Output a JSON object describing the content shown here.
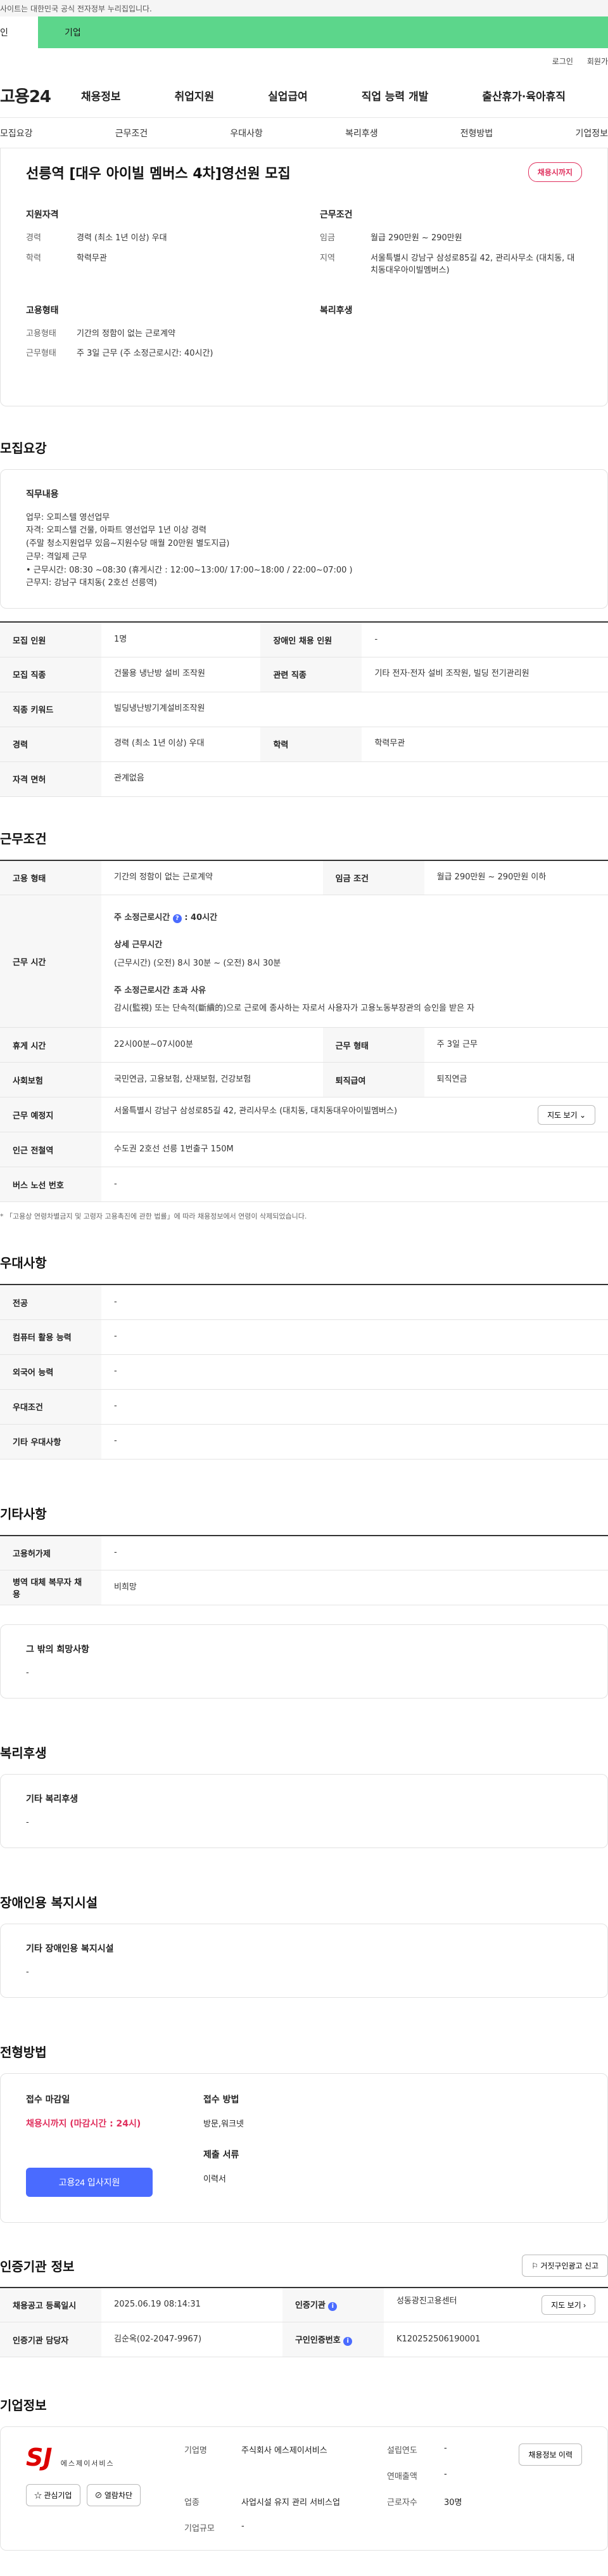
{
  "top": {
    "gov_notice": "사이트는 대한민국 공식 전자정부 누리집입니다.",
    "tab_personal": "인",
    "tab_company": "기업",
    "login": "로그인",
    "signup": "회원가"
  },
  "gnb": {
    "logo": "고용24",
    "items": [
      "채용정보",
      "취업지원",
      "실업급여",
      "직업 능력 개발",
      "출산휴가·육아휴직"
    ]
  },
  "anchor_nav": [
    "모집요강",
    "근무조건",
    "우대사항",
    "복리후생",
    "전형방법",
    "기업정보"
  ],
  "job": {
    "title": "선릉역 [대우 아이빌 멤버스 4차]영선원 모집",
    "badge": "채용시까지",
    "qual_head": "지원자격",
    "career_k": "경력",
    "career_v": "경력 (최소 1년 이상) 우대",
    "edu_k": "학력",
    "edu_v": "학력무관",
    "cond_head": "근무조건",
    "wage_k": "임금",
    "wage_v": "월급 290만원 ~ 290만원",
    "region_k": "지역",
    "region_v": "서울특별시 강남구 삼성로85길 42, 관리사무소 (대치동, 대치동대우아이빌멤버스)",
    "emp_head": "고용형태",
    "emp_type_k": "고용형태",
    "emp_type_v": "기간의 정함이 없는 근로계약",
    "work_form_k": "근무형태",
    "work_form_v": "주 3일 근무 (주 소정근로시간: 40시간)",
    "welfare_head": "복리후생"
  },
  "recruit": {
    "title": "모집요강",
    "duty_head": "직무내용",
    "duty_text": "업무: 오피스텔 영선업무\n자격: 오피스텔 건물, 아파트 영선업무 1년 이상 경력\n       (주말 청소지원업무 있음~지원수당 매월 20만원 별도지급)\n근무: 격일제 근무\n• 근무시간:  08:30 ~08:30 (휴게시간 : 12:00~13:00/ 17:00~18:00 / 22:00~07:00 )\n근무지: 강남구 대치동( 2호선 선릉역)",
    "rows": {
      "headcount_k": "모집 인원",
      "headcount_v": "1명",
      "disabled_k": "장애인 채용 인원",
      "disabled_v": "-",
      "job_k": "모집 직종",
      "job_v": "건물용 냉난방 설비 조작원",
      "rel_job_k": "관련 직종",
      "rel_job_v": "기타 전자·전자 설비 조작원, 빌딩 전기관리원",
      "keyword_k": "직종 키워드",
      "keyword_v": "빌딩냉난방기계설비조작원",
      "career_k": "경력",
      "career_v": "경력 (최소 1년 이상) 우대",
      "edu_k": "학력",
      "edu_v": "학력무관",
      "license_k": "자격 면허",
      "license_v": "관계없음"
    }
  },
  "conditions": {
    "title": "근무조건",
    "emp_type_k": "고용 형태",
    "emp_type_v": "기간의 정함이 없는 근로계약",
    "wage_k": "임금 조건",
    "wage_v": "월급 290만원 ~ 290만원 이하",
    "worktime_k": "근무 시간",
    "weekly_label": "주 소정근로시간",
    "weekly_hours": ": 40시간",
    "detail_label": "상세 근무시간",
    "detail_text": "(근무시간) (오전) 8시 30분 ~ (오전) 8시 30분",
    "excess_label": "주 소정근로시간 초과 사유",
    "excess_text": "감시(監視) 또는 단속적(斷續的)으로 근로에 종사하는 자로서 사용자가 고용노동부장관의 승인을 받은 자",
    "break_k": "휴게 시간",
    "break_v": "22시00분~07시00분",
    "work_form_k": "근무 형태",
    "work_form_v": "주 3일 근무",
    "insurance_k": "사회보험",
    "insurance_v": "국민연금, 고용보험, 산재보험, 건강보험",
    "severance_k": "퇴직급여",
    "severance_v": "퇴직연금",
    "location_k": "근무 예정지",
    "location_v": "서울특별시 강남구 삼성로85길 42, 관리사무소 (대치동, 대치동대우아이빌멤버스)",
    "map_btn": "지도 보기",
    "subway_k": "인근 전철역",
    "subway_v": "수도권 2호선 선릉 1번출구 150M",
    "bus_k": "버스 노선 번호",
    "bus_v": "-",
    "note": "* 「고용상 연령차별금지 및 고령자 고용촉진에 관한 법률」에 따라 채용정보에서 연령이 삭제되었습니다."
  },
  "preference": {
    "title": "우대사항",
    "major_k": "전공",
    "major_v": "-",
    "computer_k": "컴퓨터 활용 능력",
    "computer_v": "-",
    "language_k": "외국어 능력",
    "language_v": "-",
    "pref_k": "우대조건",
    "pref_v": "-",
    "etc_k": "기타 우대사항",
    "etc_v": "-"
  },
  "others": {
    "title": "기타사항",
    "permit_k": "고용허가제",
    "permit_v": "-",
    "military_k": "병역 대체 복무자 채용",
    "military_v": "비희망",
    "wish_head": "그 밖의 희망사항",
    "wish_v": "-"
  },
  "welfare": {
    "title": "복리후생",
    "head": "기타 복리후생",
    "v": "-"
  },
  "disabled_facility": {
    "title": "장애인용 복지시설",
    "head": "기타 장애인용 복지시설",
    "v": "-"
  },
  "selection": {
    "title": "전형방법",
    "deadline_head": "접수 마감일",
    "deadline_v": "채용시까지 (마감시간 : 24시)",
    "method_head": "접수 방법",
    "method_v": "방문,워크넷",
    "docs_head": "제출 서류",
    "docs_v": "이력서",
    "apply_btn": "고용24 입사지원"
  },
  "cert": {
    "title": "인증기관 정보",
    "report_btn": "거짓구인광고 신고",
    "reg_date_k": "채용공고 등록일시",
    "reg_date_v": "2025.06.19 08:14:31",
    "agency_k": "인증기관",
    "agency_v": "성동광진고용센터",
    "map_btn": "지도 보기",
    "manager_k": "인증기관 담당자",
    "manager_v": "김순옥(02-2047-9967)",
    "auth_no_k": "구인인증번호",
    "auth_no_v": "K120252506190001"
  },
  "company": {
    "title": "기업정보",
    "logo_text": "SJ",
    "logo_sub": "에스제이서비스",
    "fav_btn": "관심기업",
    "block_btn": "열람차단",
    "name_k": "기업명",
    "name_v": "주식회사 에스제이서비스",
    "founded_k": "설립연도",
    "founded_v": "-",
    "sales_k": "연매출액",
    "sales_v": "-",
    "industry_k": "업종",
    "industry_v": "사업시설 유지 관리 서비스업",
    "employees_k": "근로자수",
    "employees_v": "30명",
    "size_k": "기업규모",
    "size_v": "-",
    "detail_btn": "채용정보 이력"
  }
}
